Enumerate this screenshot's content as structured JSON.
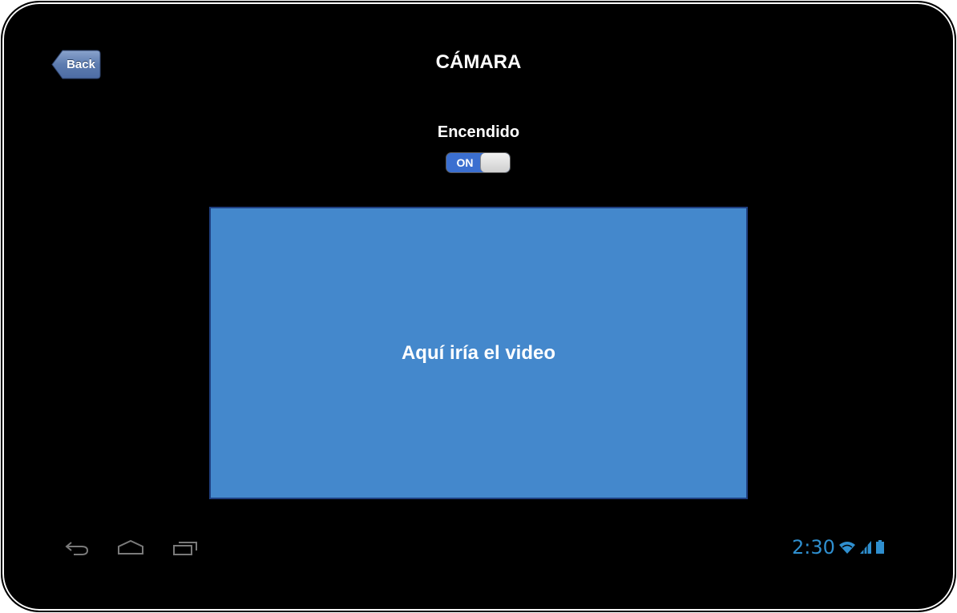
{
  "header": {
    "back_label": "Back",
    "title": "CÁMARA"
  },
  "power": {
    "label": "Encendido",
    "toggle_state": "ON"
  },
  "video": {
    "placeholder_text": "Aquí iría el video"
  },
  "navbar": {
    "icons": [
      "back-icon",
      "home-icon",
      "recent-apps-icon"
    ]
  },
  "status_bar": {
    "time": "2:30",
    "icons": [
      "wifi-icon",
      "signal-icon",
      "battery-icon"
    ]
  },
  "colors": {
    "background": "#000000",
    "video_fill": "#4488cc",
    "toggle_on": "#3b6fd0",
    "status_accent": "#2f8fcf"
  }
}
